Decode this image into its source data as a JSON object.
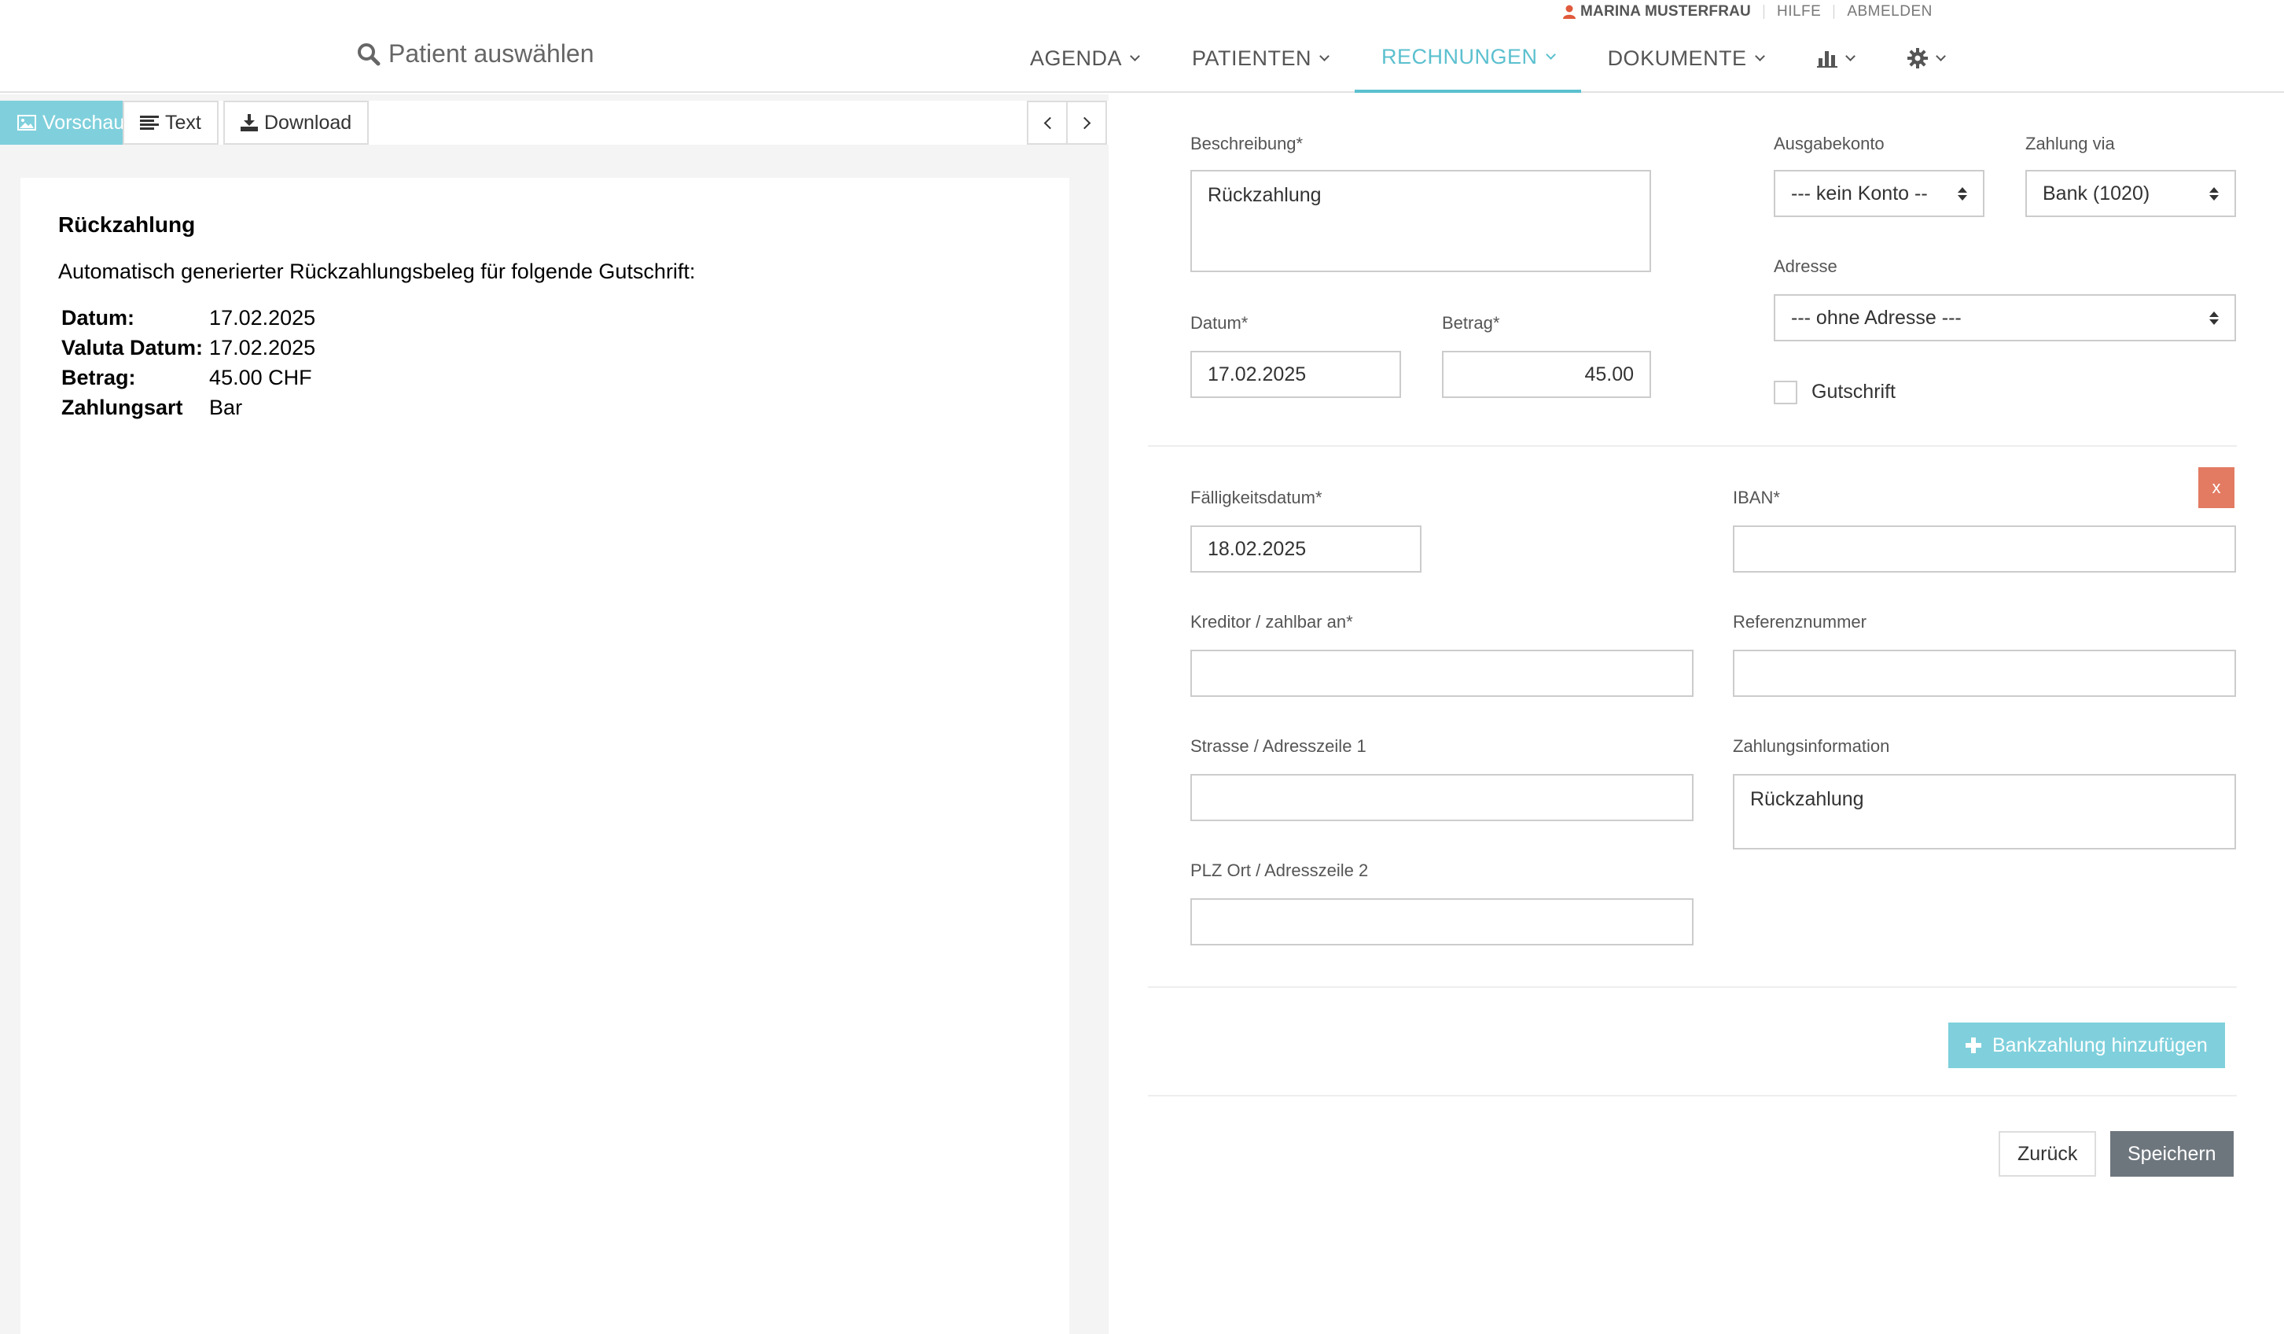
{
  "user": {
    "name": "MARINA MUSTERFRAU",
    "help": "HILFE",
    "logout": "ABMELDEN",
    "icon_color": "#e05a3c"
  },
  "header": {
    "patient_search": "Patient auswählen",
    "nav": [
      {
        "label": "AGENDA",
        "active": false
      },
      {
        "label": "PATIENTEN",
        "active": false
      },
      {
        "label": "RECHNUNGEN",
        "active": true
      },
      {
        "label": "DOKUMENTE",
        "active": false
      }
    ],
    "icons": [
      "bar-chart-icon",
      "gear-icon"
    ],
    "accent": "#5bc0cf"
  },
  "preview": {
    "tabs": {
      "preview": "Vorschau",
      "text": "Text",
      "download": "Download"
    },
    "document": {
      "title": "Rückzahlung",
      "intro": "Automatisch generierter Rückzahlungsbeleg für folgende Gutschrift:",
      "rows": [
        {
          "key": "Datum:",
          "value": "17.02.2025"
        },
        {
          "key": "Valuta Datum:",
          "value": "17.02.2025"
        },
        {
          "key": "Betrag:",
          "value": "45.00 CHF"
        },
        {
          "key": "Zahlungsart",
          "value": "Bar"
        }
      ]
    }
  },
  "form": {
    "beschreibung": {
      "label": "Beschreibung*",
      "value": "Rückzahlung"
    },
    "datum": {
      "label": "Datum*",
      "value": "17.02.2025"
    },
    "betrag": {
      "label": "Betrag*",
      "value": "45.00"
    },
    "ausgabekonto": {
      "label": "Ausgabekonto",
      "value": "--- kein Konto --"
    },
    "zahlung_via": {
      "label": "Zahlung via",
      "value": "Bank (1020)"
    },
    "adresse": {
      "label": "Adresse",
      "value": "--- ohne Adresse ---"
    },
    "gutschrift": {
      "label": "Gutschrift",
      "checked": false
    },
    "bank": {
      "remove_label": "x",
      "faelligkeitsdatum": {
        "label": "Fälligkeitsdatum*",
        "value": "18.02.2025"
      },
      "iban": {
        "label": "IBAN*",
        "value": ""
      },
      "kreditor": {
        "label": "Kreditor / zahlbar an*",
        "value": ""
      },
      "referenznummer": {
        "label": "Referenznummer",
        "value": ""
      },
      "strasse": {
        "label": "Strasse / Adresszeile 1",
        "value": ""
      },
      "zahlungsinformation": {
        "label": "Zahlungsinformation",
        "value": "Rückzahlung"
      },
      "plz_ort": {
        "label": "PLZ Ort / Adresszeile 2",
        "value": ""
      }
    },
    "add_bank_payment": "Bankzahlung hinzufügen",
    "back": "Zurück",
    "save": "Speichern"
  }
}
